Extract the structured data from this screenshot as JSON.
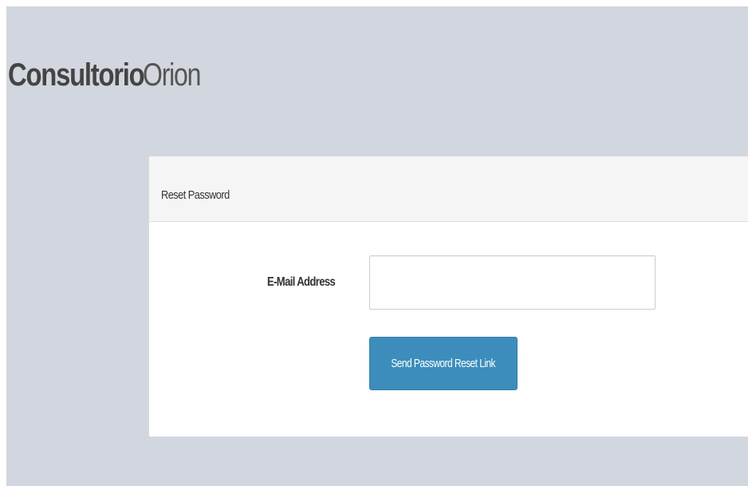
{
  "brand": {
    "strong": "Consultorio",
    "light": "Orion"
  },
  "panel": {
    "title": "Reset Password"
  },
  "form": {
    "email_label": "E-Mail Address",
    "email_value": "",
    "email_placeholder": "",
    "submit_label": "Send Password Reset Link"
  },
  "colors": {
    "background": "#d2d6de",
    "button": "#3c8dbc",
    "panel_heading": "#f5f5f5"
  }
}
